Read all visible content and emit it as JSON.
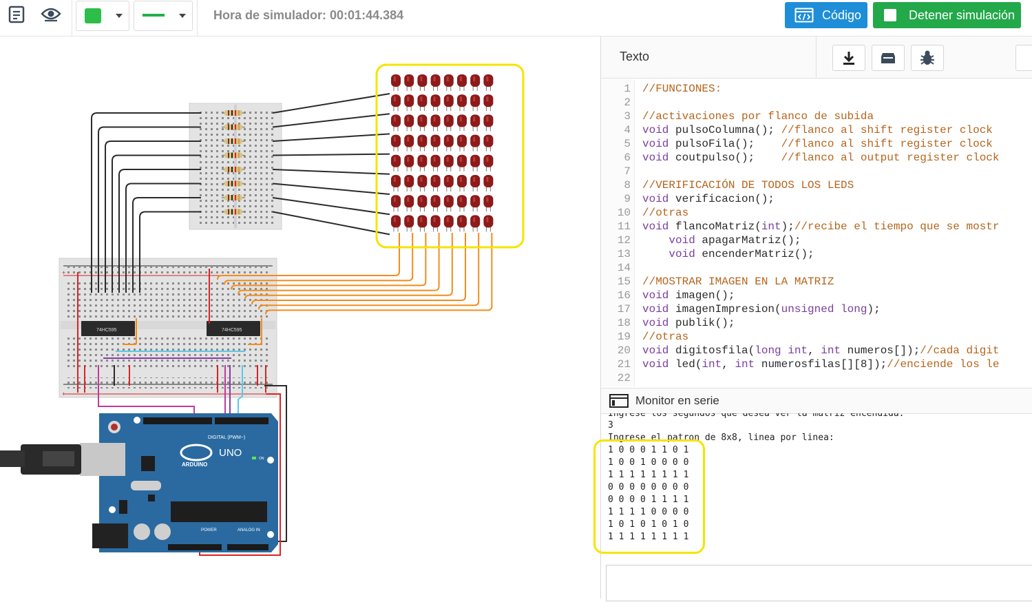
{
  "toolbar": {
    "notes_icon": "notes-icon",
    "visibility_icon": "eye-icon",
    "color_swatch": "#2dbe4a",
    "wire_swatch": "#22b04a",
    "sim_time": "Hora de simulador: 00:01:44.384",
    "code_label": "Código",
    "stop_label": "Detener simulación"
  },
  "editor": {
    "mode_label": "Texto",
    "download_icon": "download-icon",
    "library_icon": "library-icon",
    "debug_icon": "bug-icon",
    "lines": [
      "//FUNCIONES:",
      "",
      "//activaciones por flanco de subida",
      "void pulsoColumna(); //flanco al shift register clock",
      "void pulsoFila();    //flanco al shift register clock",
      "void coutpulso();    //flanco al output register clock",
      "",
      "//VERIFICACIÓN DE TODOS LOS LEDS",
      "void verificacion();",
      "//otras",
      "void flancoMatriz(int);//recibe el tiempo que se mostr",
      "    void apagarMatriz();",
      "    void encenderMatriz();",
      "",
      "//MOSTRAR IMAGEN EN LA MATRIZ",
      "void imagen();",
      "void imagenImpresion(unsigned long);",
      "void publik();",
      "//otras",
      "void digitosfila(long int, int numeros[]);//cada digit",
      "void led(int, int numerosfilas[][8]);//enciende los le",
      ""
    ]
  },
  "serial": {
    "title": "Monitor en serie",
    "lines": [
      "Ingrese los segundos que desea ver la matriz encendida:",
      "3",
      "Ingrese el patron de 8x8, linea por linea:",
      "1 0 0 0 1 1 0 1",
      "1 0 0 1 0 0 0 0",
      "1 1 1 1 1 1 1 1",
      "0 0 0 0 0 0 0 0",
      "0 0 0 0 1 1 1 1",
      "1 1 1 1 0 0 0 0",
      "1 0 1 0 1 0 1 0",
      "1 1 1 1 1 1 1 1"
    ],
    "input_value": ""
  },
  "circuit": {
    "chip1": "74HC595",
    "chip2": "74HC595",
    "board_model": "UNO",
    "board_brand": "ARDUINO",
    "digital_label": "DIGITAL (PWM~)",
    "power_label": "POWER",
    "analog_label": "ANALOG IN",
    "on_label": "ON",
    "led_rows": 8,
    "led_cols": 8,
    "highlight_color": "#f5e400"
  }
}
